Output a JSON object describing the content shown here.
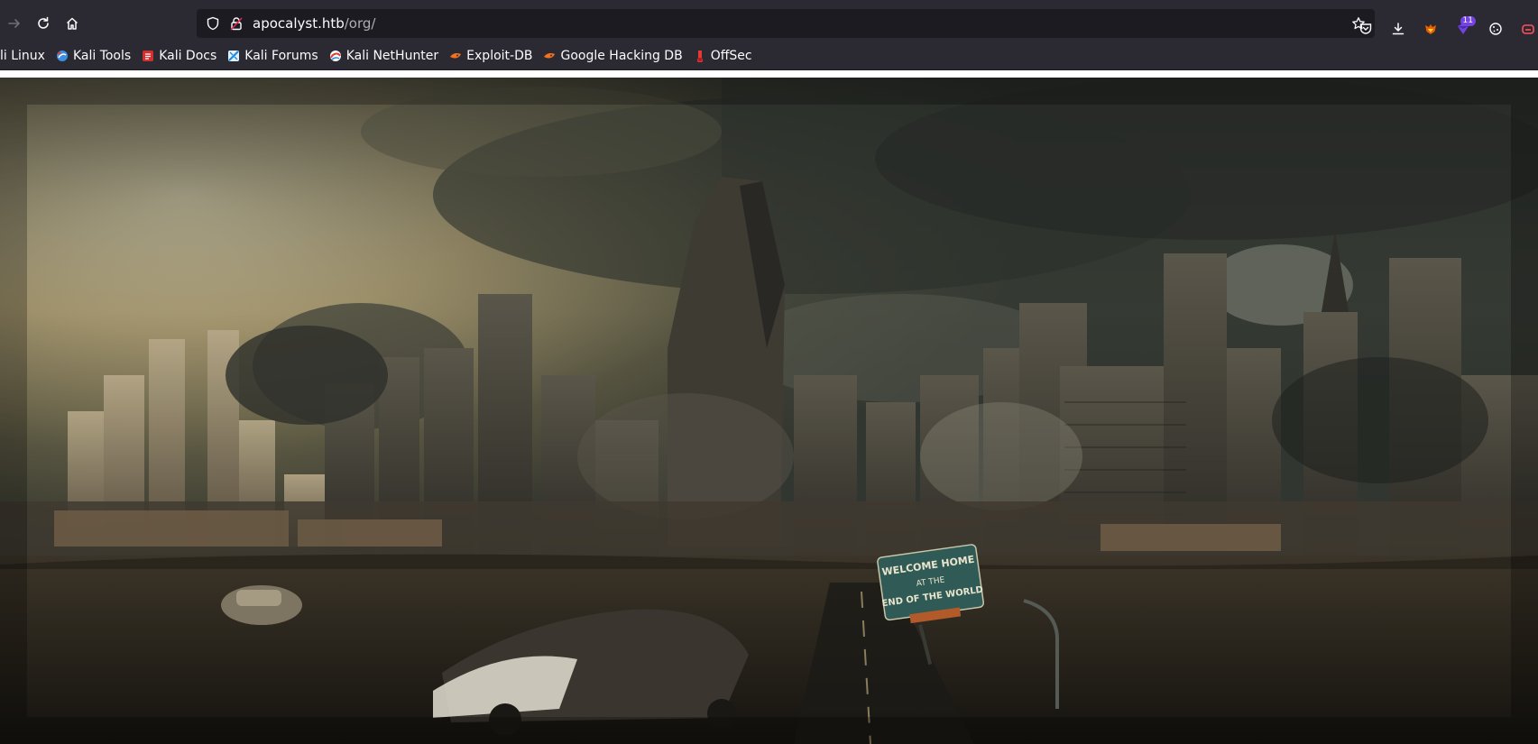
{
  "browser": {
    "url": {
      "host": "apocalyst.htb",
      "path": "/org/"
    },
    "nav": {
      "back": "back-arrow-icon",
      "forward": "forward-arrow-icon",
      "reload": "reload-icon",
      "home": "home-icon"
    },
    "toolbar_icons": [
      "pocket-icon",
      "download-icon",
      "foxyproxy-icon",
      "extension-icon",
      "cookie-icon",
      "container-icon"
    ],
    "extension_badge": "11"
  },
  "bookmarks": [
    {
      "label": "li Linux",
      "icon": "kali-icon"
    },
    {
      "label": "Kali Tools",
      "icon": "kali-tools-icon"
    },
    {
      "label": "Kali Docs",
      "icon": "kali-docs-icon"
    },
    {
      "label": "Kali Forums",
      "icon": "kali-forums-icon"
    },
    {
      "label": "Kali NetHunter",
      "icon": "nethunter-icon"
    },
    {
      "label": "Exploit-DB",
      "icon": "exploit-db-icon"
    },
    {
      "label": "Google Hacking DB",
      "icon": "ghdb-icon"
    },
    {
      "label": "OffSec",
      "icon": "offsec-icon"
    }
  ],
  "colors": {
    "chrome_bg": "#2b2a33",
    "urlbar_bg": "#1c1b22",
    "text": "#fbfbfe",
    "url_path": "#aeadb3",
    "badge": "#7542e5"
  },
  "hero": {
    "sign_lines": [
      "WELCOME HOME",
      "AT THE",
      "END OF THE WORLD"
    ]
  }
}
